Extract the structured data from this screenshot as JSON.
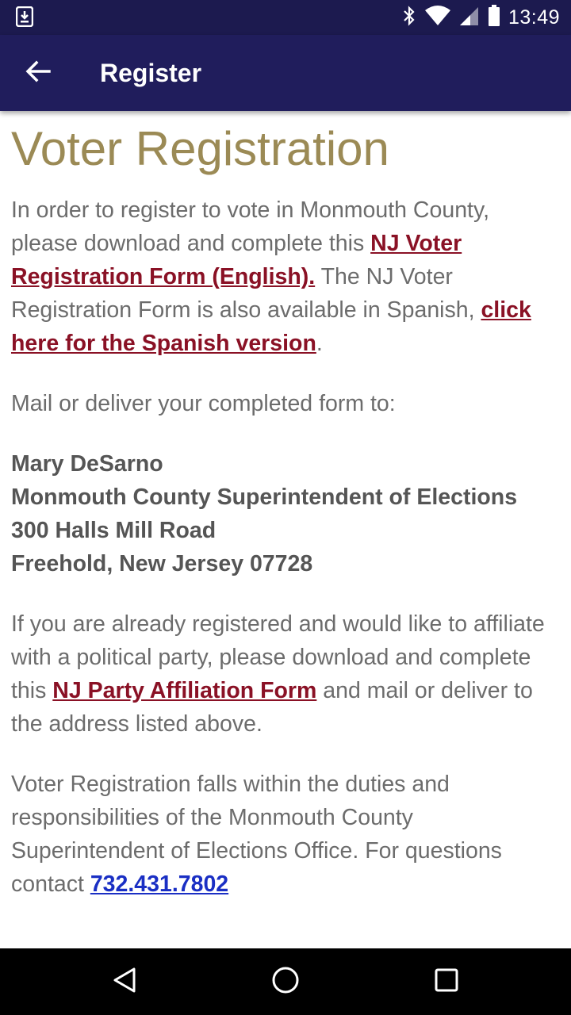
{
  "status_bar": {
    "time": "13:49",
    "icons": [
      "download-notification-icon",
      "bluetooth-icon",
      "wifi-icon",
      "cell-signal-icon",
      "battery-icon"
    ]
  },
  "app_bar": {
    "title": "Register",
    "back_icon": "arrow-back-icon",
    "background": "#201d5c"
  },
  "page": {
    "heading": "Voter Registration",
    "para1": {
      "text1": "In order to register to vote in Monmouth County, please download and complete this ",
      "link1": "NJ Voter Registration Form (English).",
      "text2": " The NJ Voter Registration Form is also available in Spanish, ",
      "link2": "click here for the Spanish version",
      "text3": "."
    },
    "para2": "Mail or deliver your completed form to:",
    "address": {
      "line1": "Mary DeSarno",
      "line2": "Monmouth County Superintendent of Elections",
      "line3": "300 Halls Mill Road",
      "line4": "Freehold, New Jersey 07728"
    },
    "para3": {
      "text1": "If you are already registered and would like to affiliate with a political party, please download and complete this ",
      "link": "NJ Party Affiliation Form",
      "text2": " and mail or deliver to the address listed above."
    },
    "para4": {
      "text1": "Voter Registration falls within the duties and responsibilities of the Monmouth County Superintendent of Elections Office. For questions contact ",
      "phone": "732.431.7802"
    }
  },
  "colors": {
    "heading": "#9b8a55",
    "link": "#8a1125",
    "phone_link": "#1a2fc4",
    "status_bar": "#1c1a4f"
  },
  "nav_bar": {
    "buttons": [
      "back-triangle-icon",
      "home-circle-icon",
      "recents-square-icon"
    ]
  }
}
